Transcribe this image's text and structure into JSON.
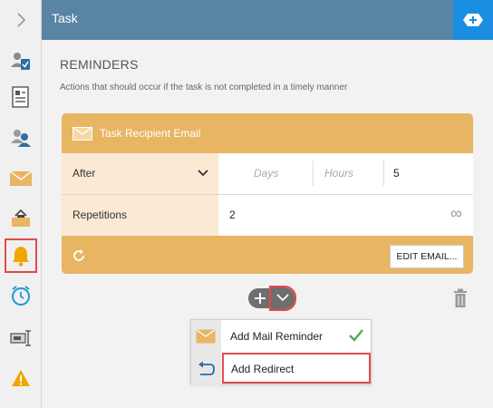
{
  "header": {
    "title": "Task"
  },
  "reminders": {
    "title": "REMINDERS",
    "description": "Actions that should occur if the task is not completed in a timely manner"
  },
  "card": {
    "title": "Task Recipient Email",
    "row1": {
      "label": "After",
      "days_placeholder": "Days",
      "hours_placeholder": "Hours",
      "minutes_value": "5"
    },
    "row2": {
      "label": "Repetitions",
      "value": "2",
      "infinite_symbol": "∞"
    },
    "edit_button": "EDIT EMAIL..."
  },
  "dropdown": {
    "items": [
      {
        "label": "Add Mail Reminder"
      },
      {
        "label": "Add Redirect"
      }
    ]
  },
  "colors": {
    "header": "#5a84a3",
    "accent": "#1a8ee0",
    "card": "#e8b562",
    "highlight": "#e34a4a"
  }
}
